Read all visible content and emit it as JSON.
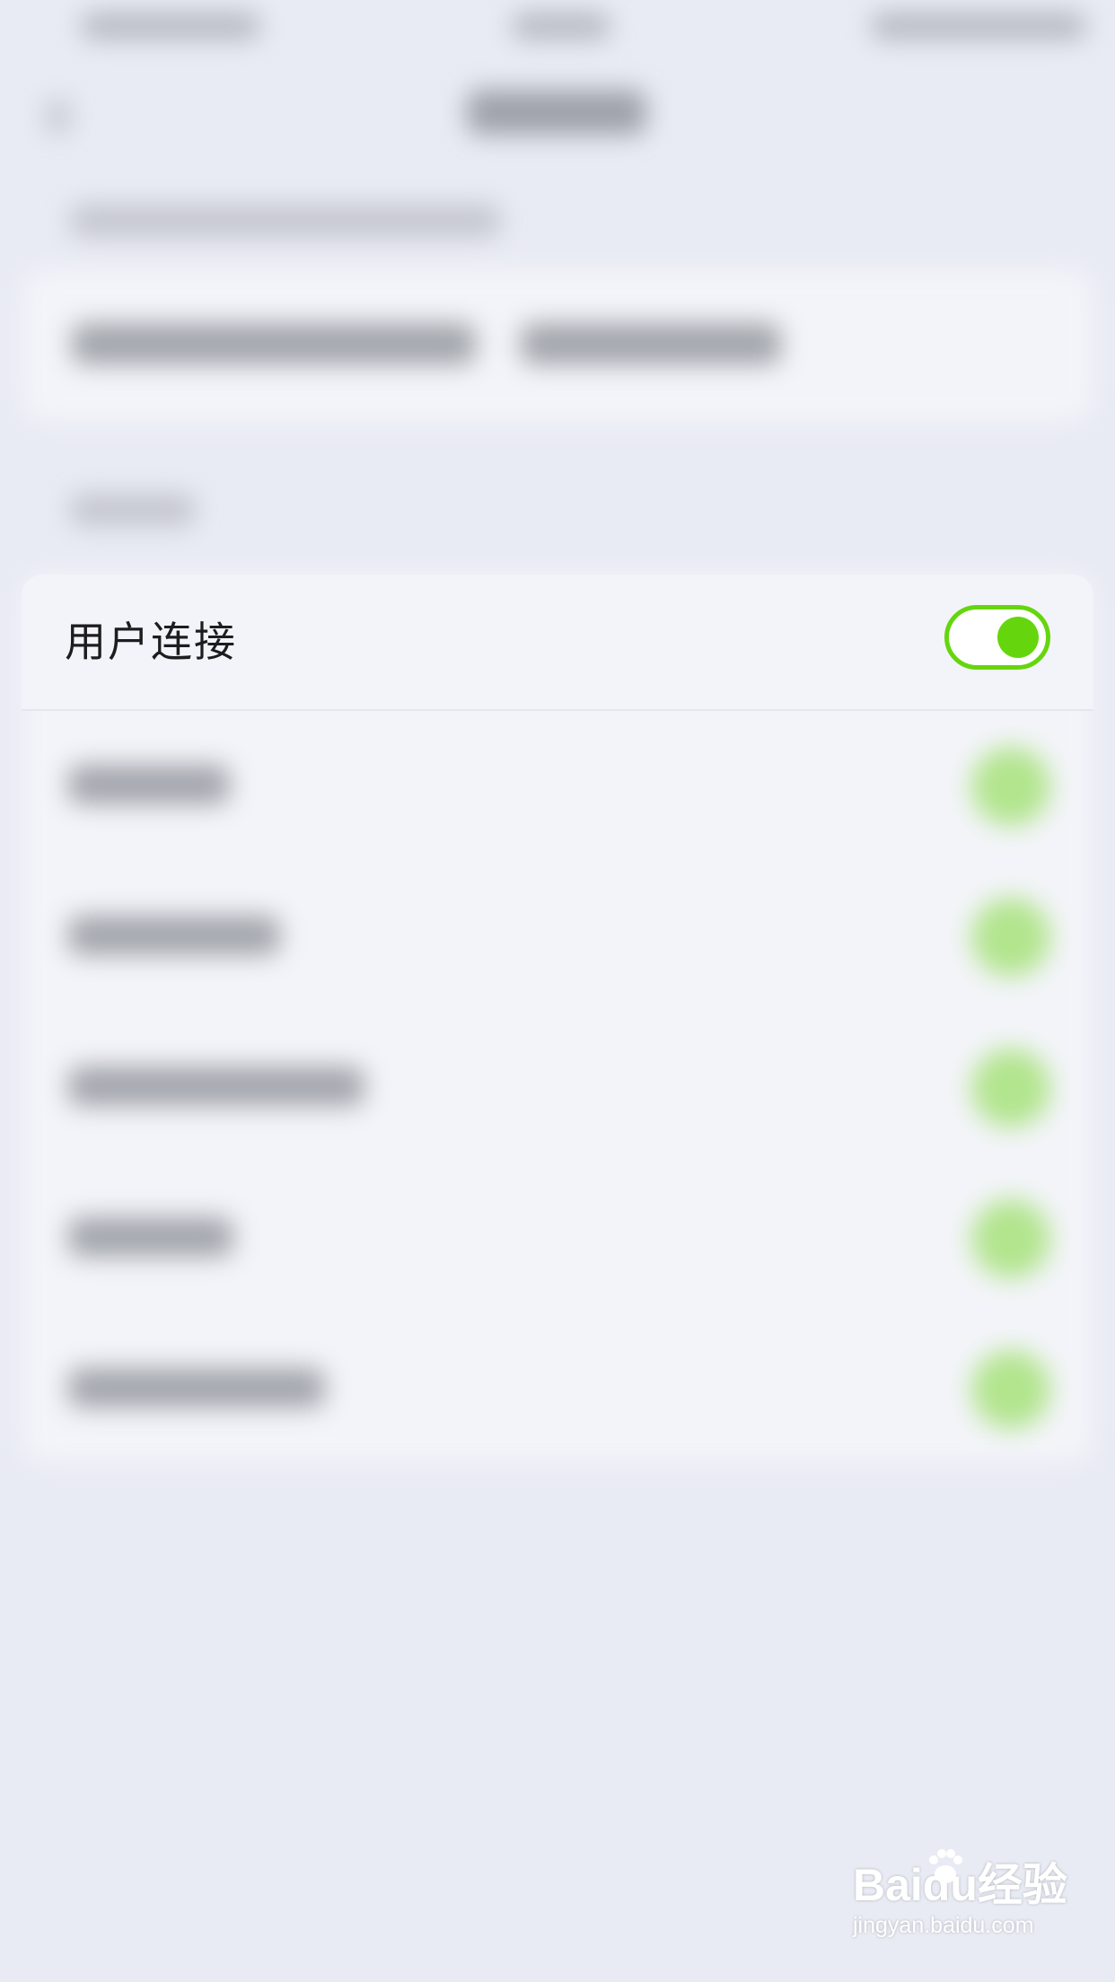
{
  "settings_row": {
    "label": "用户连接",
    "toggle_on": true
  },
  "colors": {
    "accent_green": "#65d60e",
    "background": "#e9ebf4",
    "panel": "#f3f4f9"
  },
  "watermark": {
    "main": "Baidu经验",
    "sub": "jingyan.baidu.com"
  }
}
